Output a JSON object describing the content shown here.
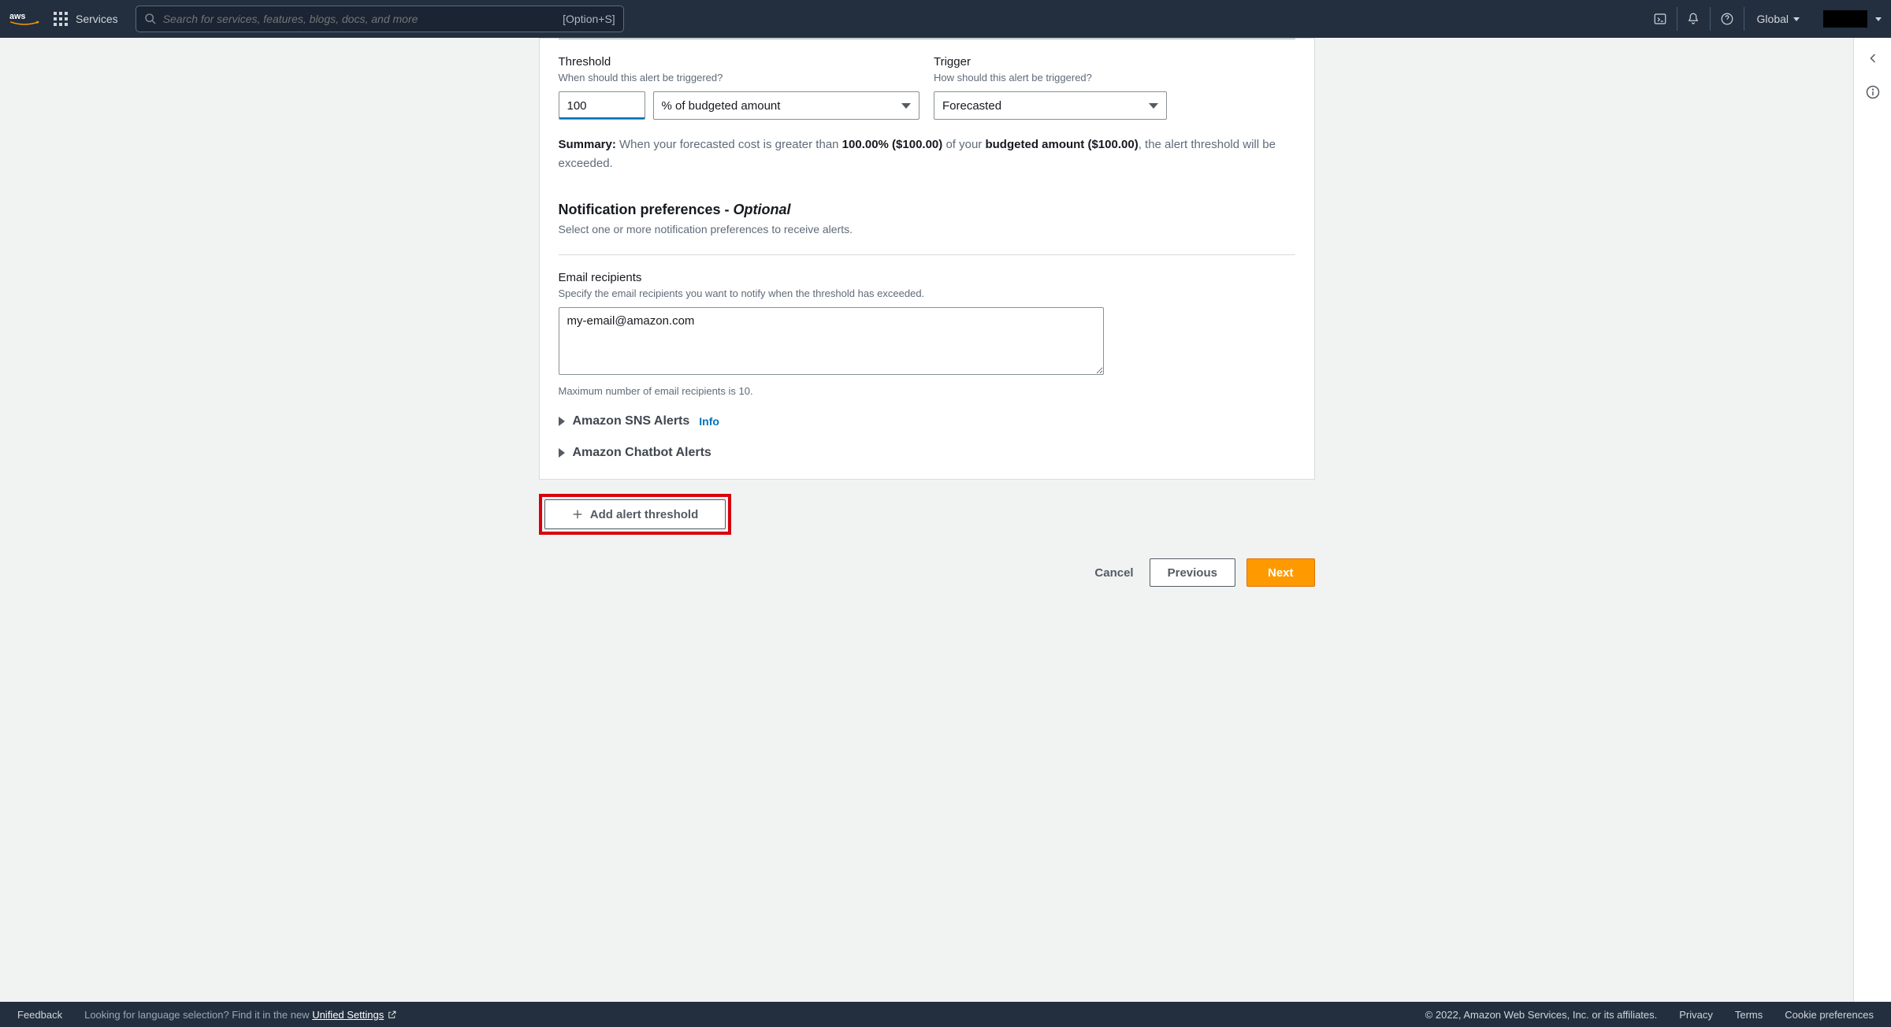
{
  "nav": {
    "services": "Services",
    "search_placeholder": "Search for services, features, blogs, docs, and more",
    "search_kbd": "[Option+S]",
    "region": "Global"
  },
  "threshold": {
    "label": "Threshold",
    "help": "When should this alert be triggered?",
    "value": "100",
    "unit": "% of budgeted amount"
  },
  "trigger": {
    "label": "Trigger",
    "help": "How should this alert be triggered?",
    "value": "Forecasted"
  },
  "summary": {
    "lead": "Summary:",
    "part1": " When your forecasted cost is greater than ",
    "pct": "100.00% ($100.00)",
    "part2": " of your ",
    "budget": "budgeted amount ($100.00)",
    "part3": ", the alert threshold will be exceeded."
  },
  "notif": {
    "head": "Notification preferences - ",
    "opt": "Optional",
    "sub": "Select one or more notification preferences to receive alerts."
  },
  "email": {
    "label": "Email recipients",
    "help": "Specify the email recipients you want to notify when the threshold has exceeded.",
    "value": "my-email@amazon.com",
    "hint": "Maximum number of email recipients is 10."
  },
  "expandos": {
    "sns": "Amazon SNS Alerts",
    "sns_info": "Info",
    "chatbot": "Amazon Chatbot Alerts"
  },
  "add_btn": "Add alert threshold",
  "actions": {
    "cancel": "Cancel",
    "previous": "Previous",
    "next": "Next"
  },
  "footer": {
    "feedback": "Feedback",
    "lang_hint": "Looking for language selection? Find it in the new ",
    "unified": "Unified Settings",
    "copyright": "© 2022, Amazon Web Services, Inc. or its affiliates.",
    "privacy": "Privacy",
    "terms": "Terms",
    "cookie": "Cookie preferences"
  }
}
